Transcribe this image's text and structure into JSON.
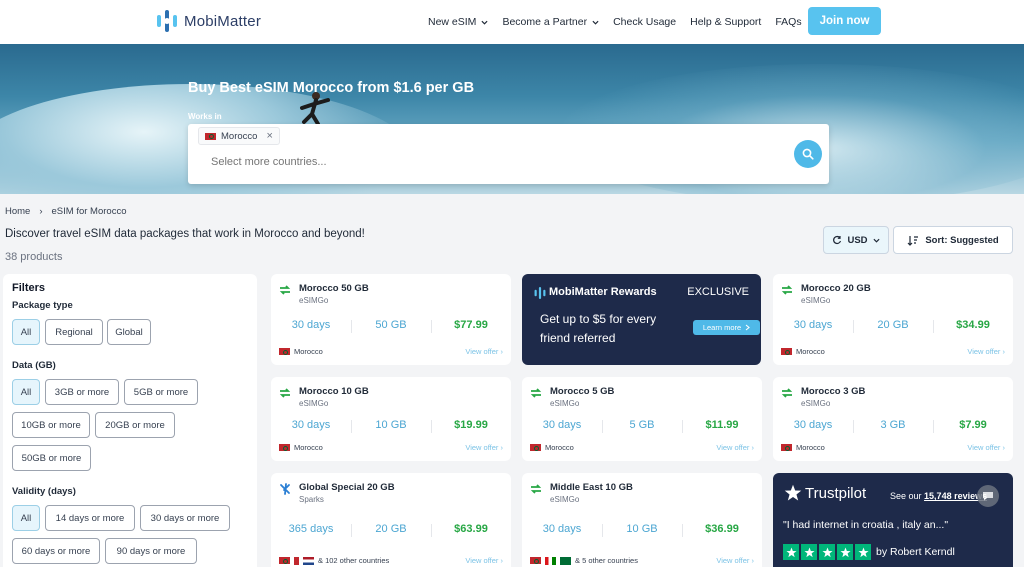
{
  "brand": {
    "name": "MobiMatter"
  },
  "nav": {
    "items": [
      {
        "label": "New eSIM",
        "dropdown": true
      },
      {
        "label": "Become a Partner",
        "dropdown": true
      },
      {
        "label": "Check Usage",
        "dropdown": false
      },
      {
        "label": "Help & Support",
        "dropdown": false
      },
      {
        "label": "FAQs",
        "dropdown": false
      }
    ],
    "join_label": "Join now"
  },
  "hero": {
    "title": "Buy Best eSIM Morocco from $1.6 per GB",
    "works_in_label": "Works in",
    "selected_country": "Morocco",
    "placeholder": "Select more countries..."
  },
  "breadcrumb": {
    "home": "Home",
    "separator": "›",
    "current": "eSIM for Morocco"
  },
  "intro": "Discover travel eSIM data packages that work in Morocco and beyond!",
  "product_count": "38 products",
  "currency": {
    "label": "USD"
  },
  "sort": {
    "label": "Sort: Suggested"
  },
  "filters": {
    "title": "Filters",
    "package_type": {
      "label": "Package type",
      "options": [
        "All",
        "Regional",
        "Global"
      ]
    },
    "data": {
      "label": "Data (GB)",
      "options": [
        "All",
        "3GB or more",
        "5GB or more",
        "10GB or more",
        "20GB or more",
        "50GB or more"
      ]
    },
    "validity": {
      "label": "Validity (days)",
      "options": [
        "All",
        "14 days or more",
        "30 days or more",
        "60 days or more",
        "90 days or more"
      ]
    }
  },
  "products": [
    {
      "name": "Morocco 50 GB",
      "provider": "eSIMGo",
      "days": "30 days",
      "data": "50 GB",
      "price": "$77.99",
      "countries": "Morocco",
      "view": "View offer ›"
    },
    {
      "name": "Morocco 20 GB",
      "provider": "eSIMGo",
      "days": "30 days",
      "data": "20 GB",
      "price": "$34.99",
      "countries": "Morocco",
      "view": "View offer ›"
    },
    {
      "name": "Morocco 10 GB",
      "provider": "eSIMGo",
      "days": "30 days",
      "data": "10 GB",
      "price": "$19.99",
      "countries": "Morocco",
      "view": "View offer ›"
    },
    {
      "name": "Morocco 5 GB",
      "provider": "eSIMGo",
      "days": "30 days",
      "data": "5 GB",
      "price": "$11.99",
      "countries": "Morocco",
      "view": "View offer ›"
    },
    {
      "name": "Morocco 3 GB",
      "provider": "eSIMGo",
      "days": "30 days",
      "data": "3 GB",
      "price": "$7.99",
      "countries": "Morocco",
      "view": "View offer ›"
    },
    {
      "name": "Global Special 20 GB",
      "provider": "Sparks",
      "days": "365 days",
      "data": "20 GB",
      "price": "$63.99",
      "countries": "& 102 other countries",
      "view": "View offer ›"
    },
    {
      "name": "Middle East 10 GB",
      "provider": "eSIMGo",
      "days": "30 days",
      "data": "10 GB",
      "price": "$36.99",
      "countries": "& 5 other countries",
      "view": "View offer ›"
    }
  ],
  "rewards": {
    "title": "MobiMatter Rewards",
    "badge": "EXCLUSIVE",
    "text": "Get up to $5 for every friend referred",
    "button": "Learn more"
  },
  "trustpilot": {
    "brand": "Trustpilot",
    "see_prefix": "See our",
    "reviews_link": "15,748 reviews",
    "quote": "\"I had internet in croatia , italy an...\"",
    "author": "by Robert Kerndl",
    "rating_stars": 5
  },
  "colors": {
    "accent": "#58c3ef",
    "price_green": "#28a745",
    "navy": "#1e2a4a",
    "trustpilot_green": "#00b67a"
  }
}
